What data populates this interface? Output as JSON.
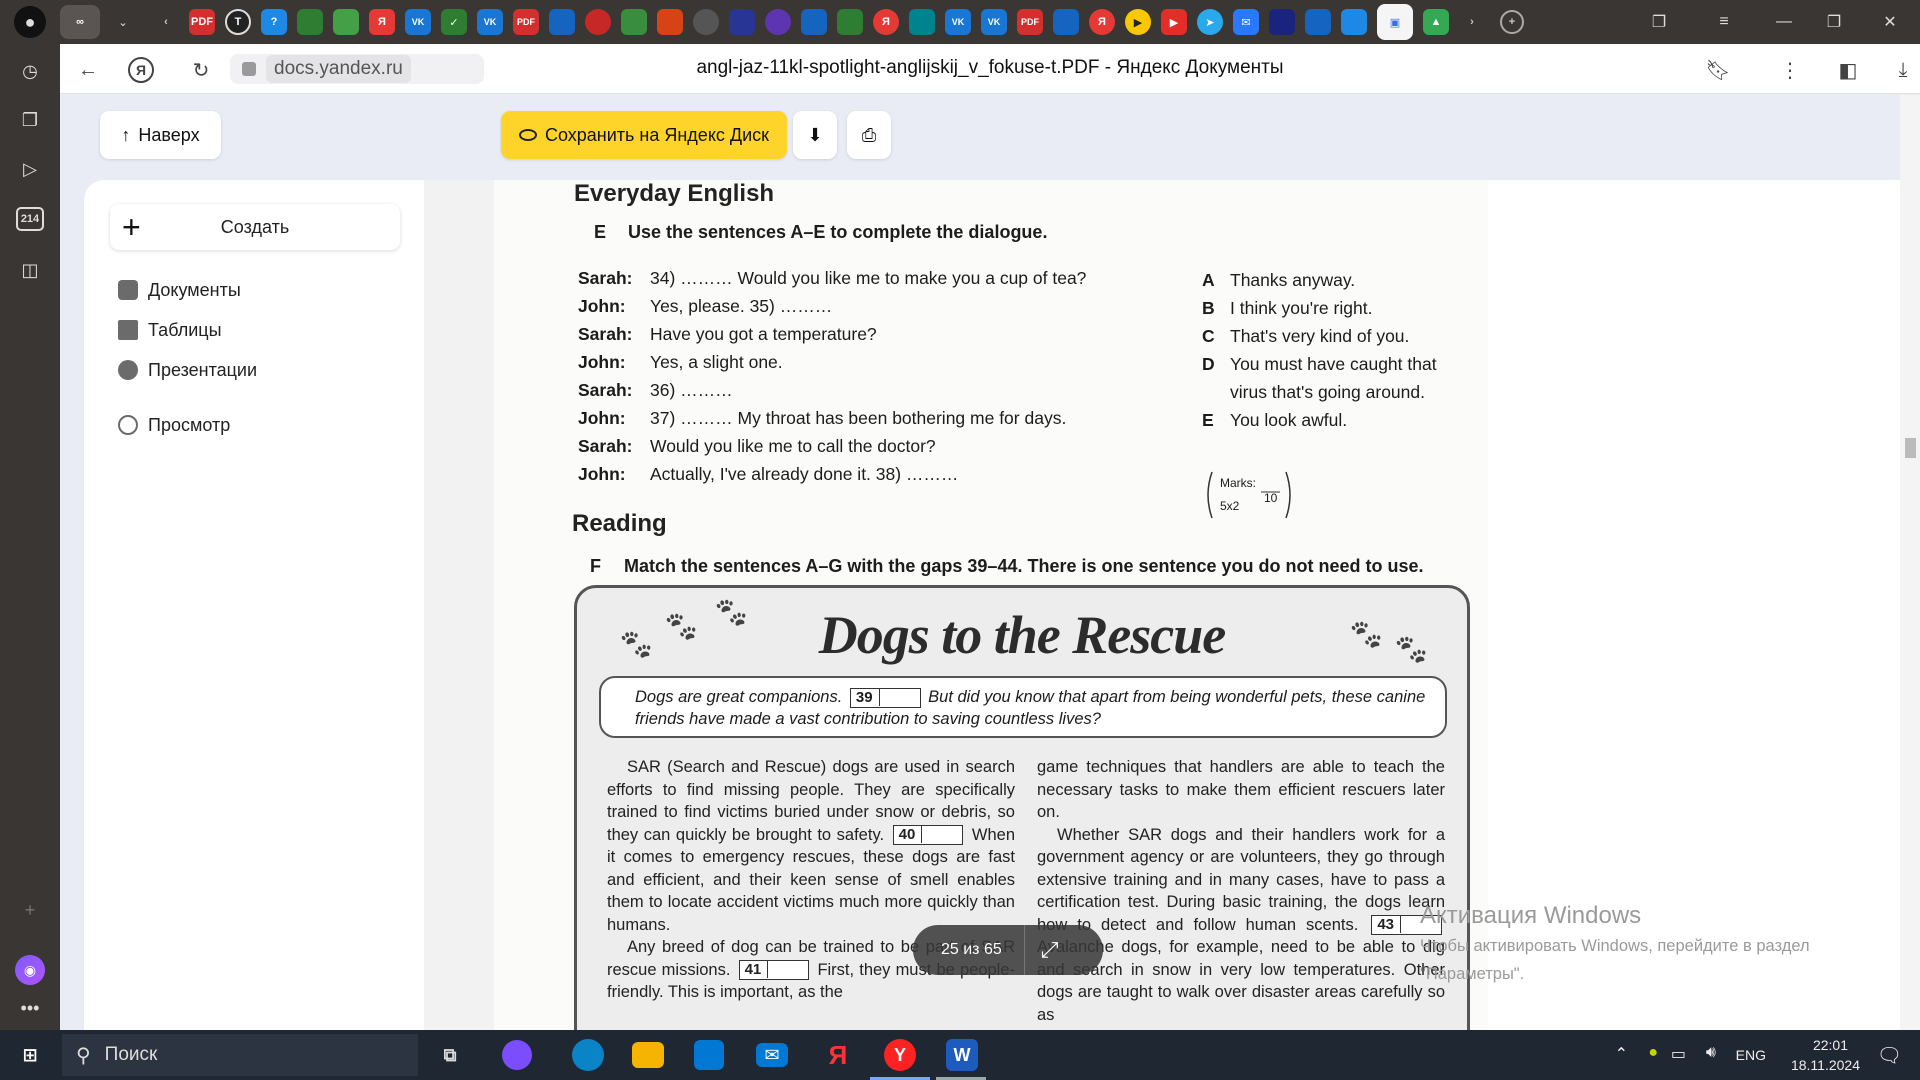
{
  "browser": {
    "address": {
      "domain": "docs.yandex.ru"
    },
    "page_title": "angl-jaz-11kl-spotlight-anglijskij_v_fokuse-t.PDF - Яндекс Документы",
    "tabs": [
      "PDF",
      "T",
      "?",
      "",
      "",
      "Я",
      "VK",
      "",
      "VK",
      "PDF",
      "",
      "",
      "",
      "",
      "",
      "",
      "",
      "",
      "",
      "Я",
      "",
      "VK",
      "VK",
      "PDF",
      "",
      "Я",
      "▶",
      "▶",
      "",
      "",
      "",
      "",
      "",
      "",
      "",
      ""
    ],
    "rail_badge": "214"
  },
  "toolbar": {
    "up_label": "Наверх",
    "save_label": "Сохранить на Яндекс Диск"
  },
  "sidebar": {
    "create_label": "Создать",
    "items": [
      {
        "label": "Документы"
      },
      {
        "label": "Таблицы"
      },
      {
        "label": "Презентации"
      },
      {
        "label": "Просмотр"
      }
    ]
  },
  "document": {
    "heading_everyday": "Everyday English",
    "task_e": {
      "letter": "E",
      "text": "Use the sentences A–E to complete the dialogue."
    },
    "dialogue": [
      {
        "speaker": "Sarah:",
        "line": "34) ……… Would you like me to make you a cup of tea?"
      },
      {
        "speaker": "John:",
        "line": "Yes, please. 35) ………"
      },
      {
        "speaker": "Sarah:",
        "line": "Have you got a temperature?"
      },
      {
        "speaker": "John:",
        "line": "Yes, a slight one."
      },
      {
        "speaker": "Sarah:",
        "line": "36) ………"
      },
      {
        "speaker": "John:",
        "line": "37) ……… My throat has been bothering me for days."
      },
      {
        "speaker": "Sarah:",
        "line": "Would you like me to call the doctor?"
      },
      {
        "speaker": "John:",
        "line": "Actually, I've already done it. 38) ………"
      }
    ],
    "options": [
      {
        "letter": "A",
        "text": "Thanks anyway."
      },
      {
        "letter": "B",
        "text": "I think you're right."
      },
      {
        "letter": "C",
        "text": "That's very kind of you."
      },
      {
        "letter": "D",
        "text": "You must have caught that"
      },
      {
        "letter": "",
        "text": "virus that's going around."
      },
      {
        "letter": "E",
        "text": "You look awful."
      }
    ],
    "marks": {
      "label": "Marks:",
      "formula": "5x2",
      "total": "10"
    },
    "heading_reading": "Reading",
    "task_f": {
      "letter": "F",
      "text": "Match the sentences A–G with the gaps 39–44. There is one sentence you do not need to use."
    },
    "article": {
      "title": "Dogs to the Rescue",
      "intro_a": "Dogs are great companions.",
      "gap_39": "39",
      "intro_b": "But did you know that apart from being wonderful pets, these canine friends have made a vast contribution to saving countless lives?",
      "left_p1a": "SAR (Search and Rescue) dogs are used in search efforts to find missing people. They are specifically trained to find victims buried under snow or debris, so they can quickly be brought to safety.",
      "gap_40": "40",
      "left_p1b": "When it comes to emergency rescues, these dogs are fast and efficient, and their keen sense of smell enables them to locate accident victims much more quickly than humans.",
      "left_p2a": "Any breed of dog can be trained to be part of SAR rescue missions.",
      "gap_41": "41",
      "left_p2b": "First, they must be people-friendly. This is important, as the",
      "right_p1": "game techniques that handlers are able to teach the necessary tasks to make them efficient rescuers later on.",
      "right_p2a": "Whether SAR dogs and their handlers work for a government agency or are volunteers, they go through extensive training and in many cases, have to pass a certification test. During basic training, the dogs learn how to detect and follow human scents.",
      "gap_43": "43",
      "right_p2b": "Avalanche dogs, for example, need to be able to dig and search in snow in very low temperatures. Other dogs are taught to walk over disaster areas carefully so as"
    }
  },
  "pager": {
    "text": "25 из 65"
  },
  "windows_activation": {
    "title": "Активация Windows",
    "line1": "Чтобы активировать Windows, перейдите в раздел",
    "line2": "\"Параметры\"."
  },
  "taskbar": {
    "search_label": "Поиск",
    "lang": "ENG",
    "time": "22:01",
    "date": "18.11.2024"
  },
  "colors": {
    "chrome_dark": "#3a3633",
    "save_yellow": "#fed42b",
    "taskbar": "#1f2733"
  }
}
